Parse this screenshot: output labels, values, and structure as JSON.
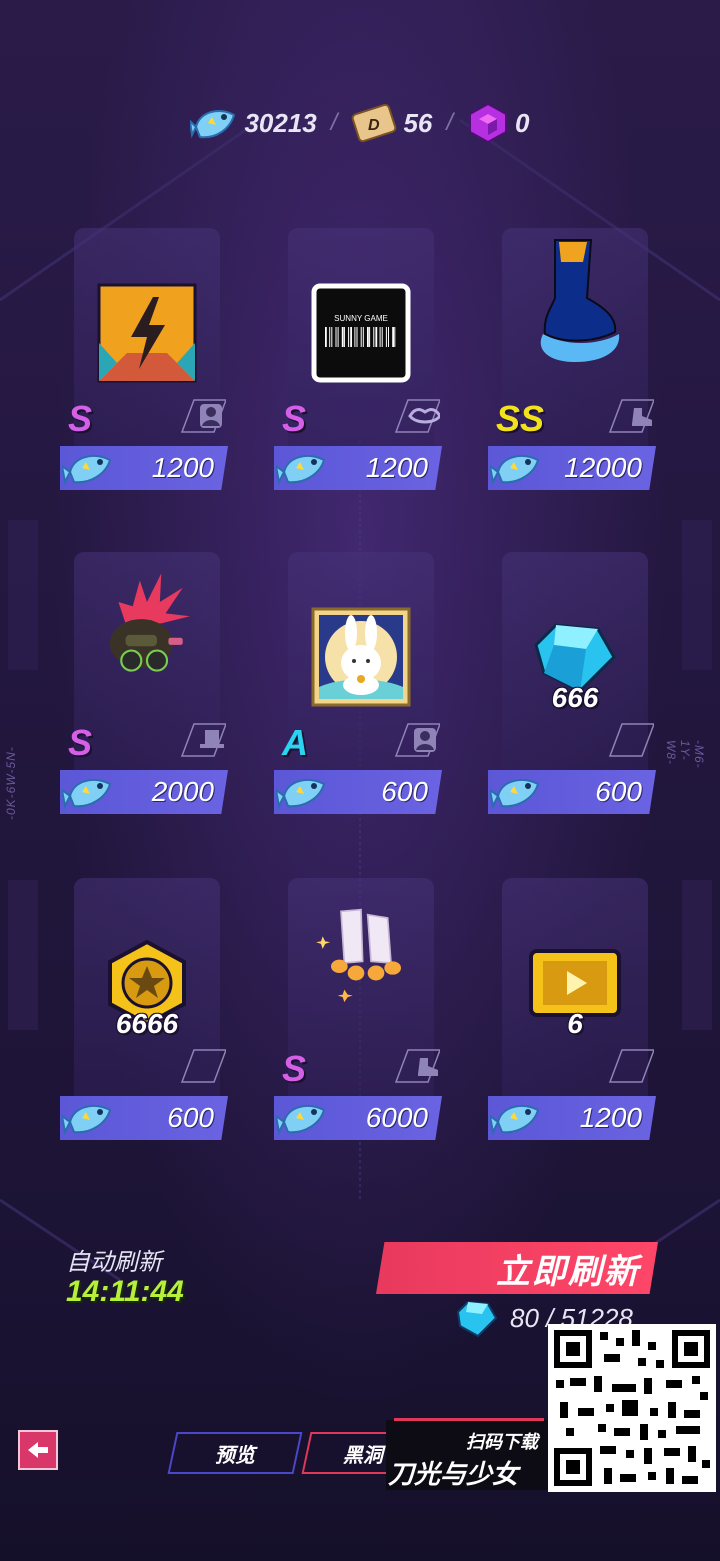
{
  "currency": {
    "fish": "30213",
    "ticket": "56",
    "cube": "0",
    "sep1": "/",
    "sep2": "/"
  },
  "cards": [
    {
      "rank": "S",
      "rank_color": "#d65fe8",
      "price": "1200",
      "qty": "",
      "slot_icon": "portrait-icon",
      "item": "lightning-frame-icon"
    },
    {
      "rank": "S",
      "rank_color": "#d65fe8",
      "price": "1200",
      "qty": "",
      "slot_icon": "lips-icon",
      "item": "barcode-card-icon",
      "item_text": "SUNNY GAME"
    },
    {
      "rank": "SS",
      "rank_color": "#f2e21a",
      "price": "12000",
      "qty": "",
      "slot_icon": "shoe-icon",
      "item": "boot-icon"
    },
    {
      "rank": "S",
      "rank_color": "#d65fe8",
      "price": "2000",
      "qty": "",
      "slot_icon": "hat-icon",
      "item": "punk-hair-costume-icon"
    },
    {
      "rank": "A",
      "rank_color": "#2ad3f0",
      "price": "600",
      "qty": "",
      "slot_icon": "portrait-icon",
      "item": "rabbit-frame-icon"
    },
    {
      "rank": "",
      "rank_color": "",
      "price": "600",
      "qty": "666",
      "slot_icon": "",
      "item": "blue-gem-icon"
    },
    {
      "rank": "",
      "rank_color": "",
      "price": "600",
      "qty": "6666",
      "slot_icon": "",
      "item": "gold-star-coin-icon"
    },
    {
      "rank": "S",
      "rank_color": "#d65fe8",
      "price": "6000",
      "qty": "",
      "slot_icon": "shoe-icon",
      "item": "white-socks-icon"
    },
    {
      "rank": "",
      "rank_color": "",
      "price": "1200",
      "qty": "6",
      "slot_icon": "",
      "item": "gold-video-ticket-icon"
    }
  ],
  "auto_refresh": {
    "label": "自动刷新",
    "time": "14:11:44"
  },
  "refresh": {
    "label": "立即刷新",
    "cost": "80 / 51228"
  },
  "tabs": {
    "preview": "预览",
    "black": "黑洞"
  },
  "promo": {
    "line1": "扫码下载",
    "line2": "刀光与少女"
  },
  "side_left": "-0K-6W-5N-",
  "side_right": "-M6-1Y-W8-"
}
